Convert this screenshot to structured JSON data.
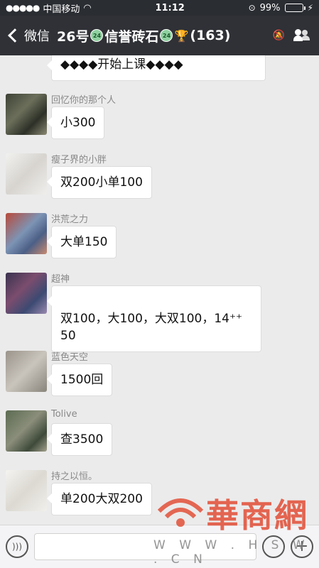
{
  "status_bar": {
    "carrier": "中国移动",
    "time": "11:12",
    "battery": "99%",
    "battery_level": 0.99
  },
  "nav": {
    "back_label": "微信",
    "title_prefix": "26号",
    "title_mid": "信誉砖石",
    "member_count": "(163)"
  },
  "partial_message": {
    "text": "◆◆◆◆开始上课◆◆◆◆"
  },
  "messages": [
    {
      "name": "回忆你的那个人",
      "text": "小300"
    },
    {
      "name": "瘦子界的小胖",
      "text": "双200小单100"
    },
    {
      "name": "洪荒之力",
      "text": "大单150"
    },
    {
      "name": "超神",
      "text": "双100，大100，大双100，14⁺⁺\n50"
    },
    {
      "name": "蓝色天空",
      "text": "1500回"
    },
    {
      "name": "Tolive",
      "text": "查3500"
    },
    {
      "name": "持之以恒。",
      "text": "单200大双200"
    }
  ],
  "watermark": {
    "brand": "華商網",
    "url": "W W W . H S W . C N"
  }
}
